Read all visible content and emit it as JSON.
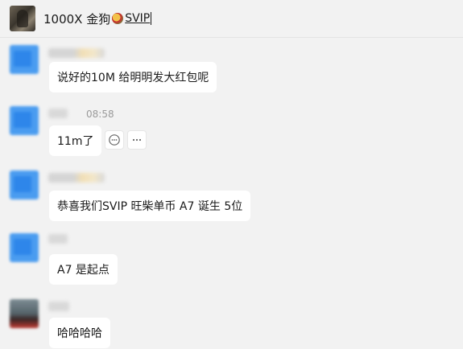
{
  "header": {
    "title": "1000X 金狗",
    "tag": "SVIP"
  },
  "messages": [
    {
      "id": 1,
      "time": "",
      "text": "说好的10M 给明明发大红包呢"
    },
    {
      "id": 2,
      "time": "08:58",
      "text": "11m了"
    },
    {
      "id": 3,
      "time": "",
      "text": "恭喜我们SVIP 旺柴单币 A7 诞生  5位"
    },
    {
      "id": 4,
      "time": "",
      "text": "A7 是起点"
    },
    {
      "id": 5,
      "time": "",
      "text": "哈哈哈哈"
    }
  ],
  "colors": {
    "background": "#f2f2f2",
    "bubble": "#ffffff",
    "avatar_blue": "#4a9cf0",
    "text": "#1a1a1a",
    "time": "#9a9a9a"
  },
  "icons": [
    "comment-icon",
    "more-icon"
  ]
}
